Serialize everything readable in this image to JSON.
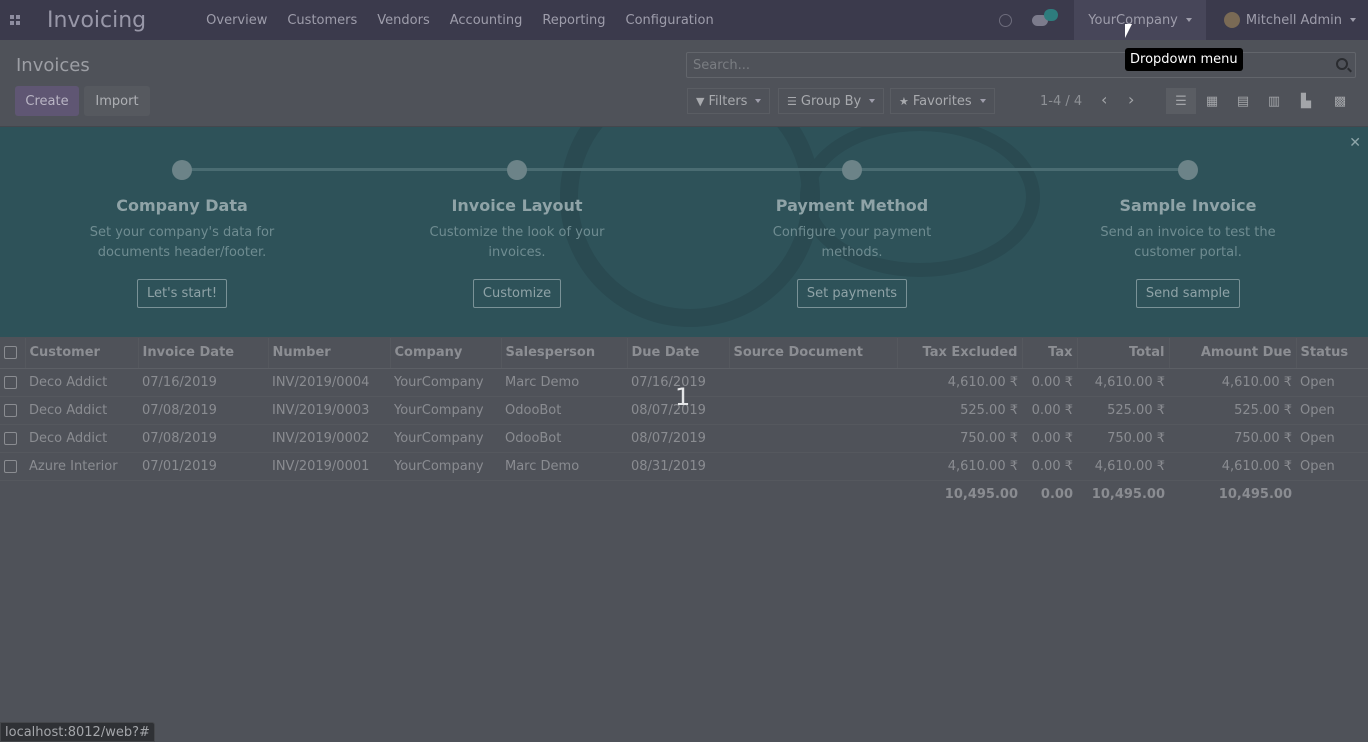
{
  "navbar": {
    "app_title": "Invoicing",
    "menu": [
      "Overview",
      "Customers",
      "Vendors",
      "Accounting",
      "Reporting",
      "Configuration"
    ],
    "company": "YourCompany",
    "user": "Mitchell Admin"
  },
  "control_panel": {
    "title": "Invoices",
    "create_label": "Create",
    "import_label": "Import",
    "search_placeholder": "Search...",
    "filters_label": "Filters",
    "group_by_label": "Group By",
    "favorites_label": "Favorites",
    "pager": "1-4 / 4",
    "views": [
      "list-view-icon",
      "kanban-view-icon",
      "calendar-view-icon",
      "pivot-view-icon",
      "graph-view-icon",
      "activity-view-icon"
    ]
  },
  "onboarding": {
    "steps": [
      {
        "title": "Company Data",
        "desc": "Set your company's data for documents header/footer.",
        "button": "Let's start!"
      },
      {
        "title": "Invoice Layout",
        "desc": "Customize the look of your invoices.",
        "button": "Customize"
      },
      {
        "title": "Payment Method",
        "desc": "Configure your payment methods.",
        "button": "Set payments"
      },
      {
        "title": "Sample Invoice",
        "desc": "Send an invoice to test the customer portal.",
        "button": "Send sample"
      }
    ]
  },
  "table": {
    "headers": [
      "Customer",
      "Invoice Date",
      "Number",
      "Company",
      "Salesperson",
      "Due Date",
      "Source Document",
      "Tax Excluded",
      "Tax",
      "Total",
      "Amount Due",
      "Status"
    ],
    "rows": [
      [
        "Deco Addict",
        "07/16/2019",
        "INV/2019/0004",
        "YourCompany",
        "Marc Demo",
        "07/16/2019",
        "",
        "4,610.00 ₹",
        "0.00 ₹",
        "4,610.00 ₹",
        "4,610.00 ₹",
        "Open"
      ],
      [
        "Deco Addict",
        "07/08/2019",
        "INV/2019/0003",
        "YourCompany",
        "OdooBot",
        "08/07/2019",
        "",
        "525.00 ₹",
        "0.00 ₹",
        "525.00 ₹",
        "525.00 ₹",
        "Open"
      ],
      [
        "Deco Addict",
        "07/08/2019",
        "INV/2019/0002",
        "YourCompany",
        "OdooBot",
        "08/07/2019",
        "",
        "750.00 ₹",
        "0.00 ₹",
        "750.00 ₹",
        "750.00 ₹",
        "Open"
      ],
      [
        "Azure Interior",
        "07/01/2019",
        "INV/2019/0001",
        "YourCompany",
        "Marc Demo",
        "08/31/2019",
        "",
        "4,610.00 ₹",
        "0.00 ₹",
        "4,610.00 ₹",
        "4,610.00 ₹",
        "Open"
      ]
    ],
    "totals": {
      "tax_excluded": "10,495.00",
      "tax": "0.00",
      "total": "10,495.00",
      "amount_due": "10,495.00"
    }
  },
  "overlay_number": "1",
  "tooltip": "Dropdown menu",
  "status_url": "localhost:8012/web?#"
}
